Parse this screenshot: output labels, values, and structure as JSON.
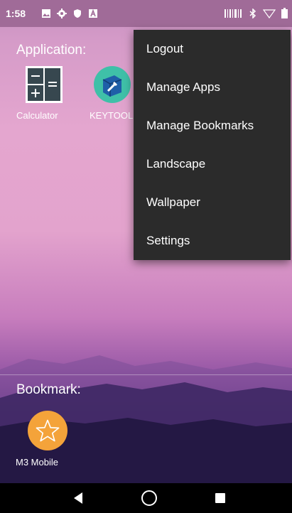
{
  "status_bar": {
    "time": "1:58",
    "icons_left": [
      "image-icon",
      "gear-icon",
      "shield-icon",
      "a-badge-icon"
    ],
    "icons_right": [
      "barcode-icon",
      "bluetooth-icon",
      "wifi-icon",
      "battery-icon"
    ]
  },
  "applications": {
    "heading": "Application:",
    "items": [
      {
        "label": "Calculator",
        "icon": "calculator-icon"
      },
      {
        "label": "KEYTOOL",
        "icon": "keytool-icon"
      }
    ]
  },
  "overflow_menu": {
    "items": [
      {
        "label": "Logout"
      },
      {
        "label": "Manage Apps"
      },
      {
        "label": "Manage Bookmarks"
      },
      {
        "label": "Landscape"
      },
      {
        "label": "Wallpaper"
      },
      {
        "label": "Settings"
      }
    ]
  },
  "bookmarks": {
    "heading": "Bookmark:",
    "items": [
      {
        "label": "M3 Mobile",
        "icon": "star-icon"
      }
    ]
  },
  "nav_bar": {
    "buttons": [
      "back-icon",
      "home-icon",
      "recents-icon"
    ]
  },
  "colors": {
    "menu_background": "#2b2b2b",
    "status_bar": "#a06b98",
    "bookmark_orange": "#f4a33a",
    "keytool_teal": "#3fc0a8"
  }
}
